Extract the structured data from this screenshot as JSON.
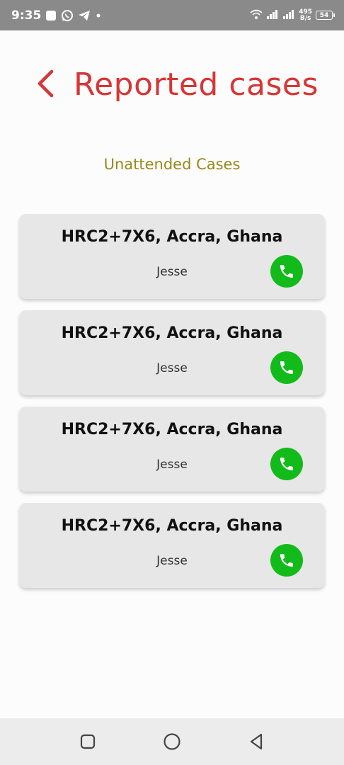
{
  "status_bar": {
    "time": "9:35",
    "speed_value": "495",
    "speed_unit": "B/s",
    "battery": "54",
    "icons": [
      "square-notification-icon",
      "whatsapp-icon",
      "telegram-icon",
      "dot-icon",
      "wifi-icon",
      "signal-icon",
      "signal-icon-2"
    ]
  },
  "header": {
    "title": "Reported cases",
    "back_icon": "chevron-left-icon"
  },
  "section": {
    "label": "Unattended Cases"
  },
  "cases": [
    {
      "location": "HRC2+7X6, Accra, Ghana",
      "name": "Jesse"
    },
    {
      "location": "HRC2+7X6, Accra, Ghana",
      "name": "Jesse"
    },
    {
      "location": "HRC2+7X6, Accra, Ghana",
      "name": "Jesse"
    },
    {
      "location": "HRC2+7X6, Accra, Ghana",
      "name": "Jesse"
    }
  ],
  "nav": {
    "icons": [
      "recent-apps-icon",
      "home-icon",
      "back-icon"
    ]
  },
  "colors": {
    "accent": "#d63636",
    "section": "#98891a",
    "call": "#12bb1a",
    "card": "#e7e7e7"
  }
}
